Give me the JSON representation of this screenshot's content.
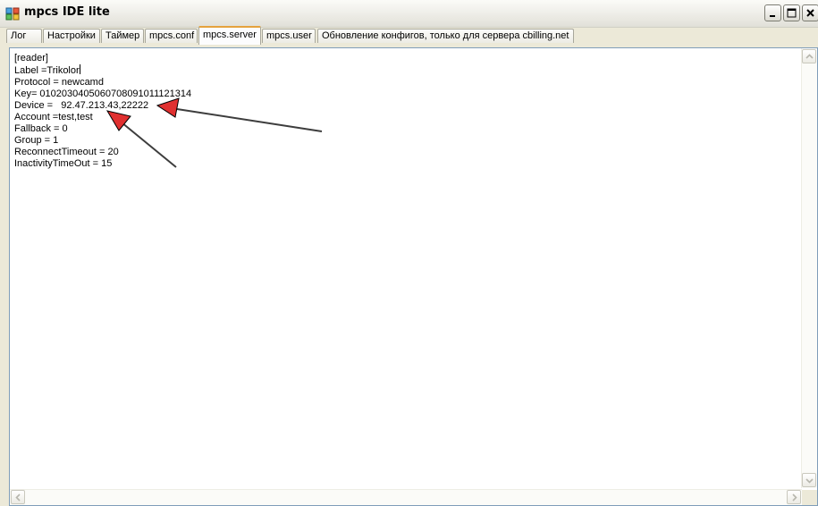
{
  "window": {
    "title": "mpcs IDE lite",
    "icon": "app-icon",
    "controls": {
      "minimize": "minimize-icon",
      "maximize": "maximize-icon",
      "close": "close-icon"
    }
  },
  "tabs": [
    {
      "label": "Лог"
    },
    {
      "label": "Настройки"
    },
    {
      "label": "Таймер"
    },
    {
      "label": "mpcs.conf"
    },
    {
      "label": "mpcs.server",
      "active": true
    },
    {
      "label": "mpcs.user"
    },
    {
      "label": "Обновление конфигов, только для сервера cbilling.net"
    }
  ],
  "editor": {
    "lines": [
      "[reader]",
      "Label =Trikolor",
      "Protocol = newcamd",
      "Key= 0102030405060708091011121314",
      "Device =   92.47.213.43,22222",
      "Account =test,test",
      "Fallback = 0",
      "Group = 1",
      "ReconnectTimeout = 20",
      "InactivityTimeOut = 15"
    ]
  },
  "annotations": {
    "arrow_color": "#e03030"
  }
}
